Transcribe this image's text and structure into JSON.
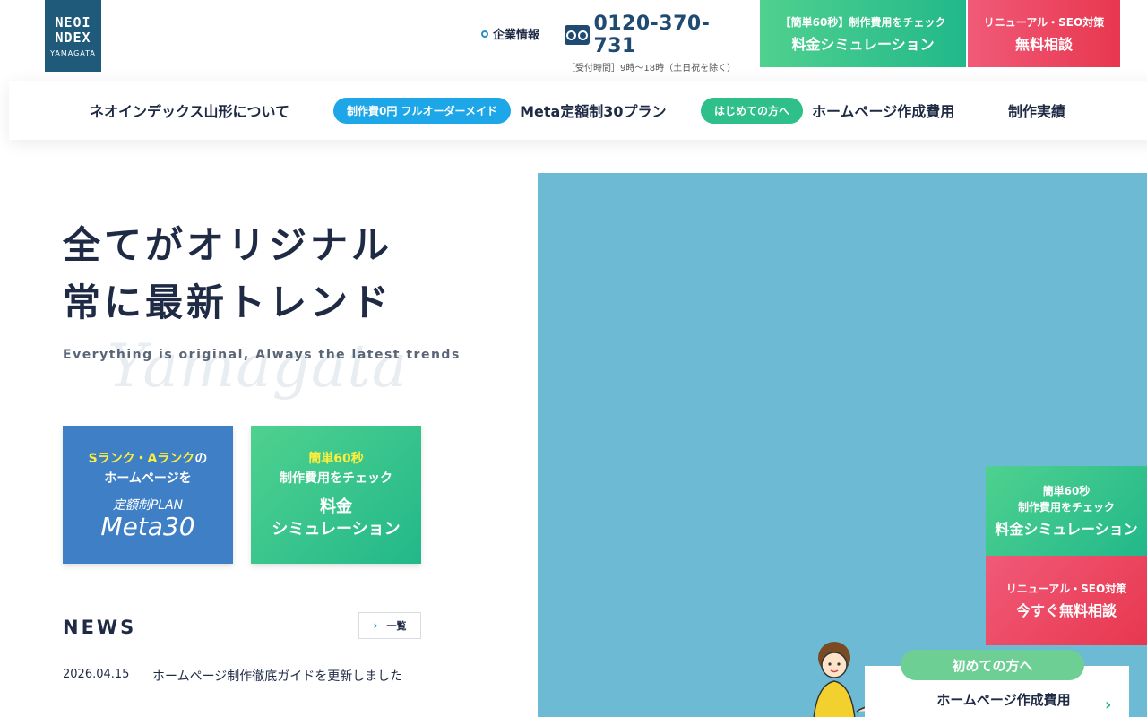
{
  "header": {
    "logo": {
      "line1": "NEOI",
      "line2": "NDEX",
      "line3": "YAMAGATA"
    },
    "corp_link": "企業情報",
    "tel": {
      "number": "0120-370-731",
      "hours": "［受付時間］9時〜18時（土日祝を除く）"
    },
    "cta_simulation": {
      "small": "【簡単60秒】制作費用をチェック",
      "large": "料金シミュレーション"
    },
    "cta_consult": {
      "small": "リニューアル・SEO対策",
      "large": "無料相談"
    }
  },
  "nav": {
    "about": "ネオインデックス山形について",
    "fullorder_pill": "制作費0円 フルオーダーメイド",
    "meta30": "Meta定額制30プラン",
    "beginner_pill": "はじめての方へ",
    "cost": "ホームページ作成費用",
    "works": "制作実績"
  },
  "hero": {
    "title_line1": "全てがオリジナル",
    "title_line2": "常に最新トレンド",
    "subtitle": "Everything is original, Always the latest trends",
    "script": "Yamagata"
  },
  "cards": {
    "meta": {
      "highlight": "Sランク・Aランク",
      "line1_suffix": "の",
      "line2": "ホームページを",
      "plan_small": "定額制PLAN",
      "plan_large": "Meta30"
    },
    "simulation": {
      "highlight": "簡単60秒",
      "line2": "制作費用をチェック",
      "big1": "料金",
      "big2": "シミュレーション"
    }
  },
  "news": {
    "title": "NEWS",
    "more": "一覧",
    "items": [
      {
        "date": "2026.04.15",
        "text": "ホームページ制作徹底ガイドを更新しました"
      }
    ]
  },
  "side": {
    "simulation": {
      "small1": "簡単60秒",
      "small2": "制作費用をチェック",
      "large": "料金シミュレーション"
    },
    "consult": {
      "small": "リニューアル・SEO対策",
      "large": "今すぐ無料相談"
    }
  },
  "guide": {
    "pill": "初めての方へ",
    "text": "ホームページ作成費用"
  },
  "colors": {
    "navy": "#1f2a44",
    "green": "#22b88a",
    "red": "#e8374f",
    "blue": "#3e7fc6",
    "sky": "#6cbad3"
  }
}
